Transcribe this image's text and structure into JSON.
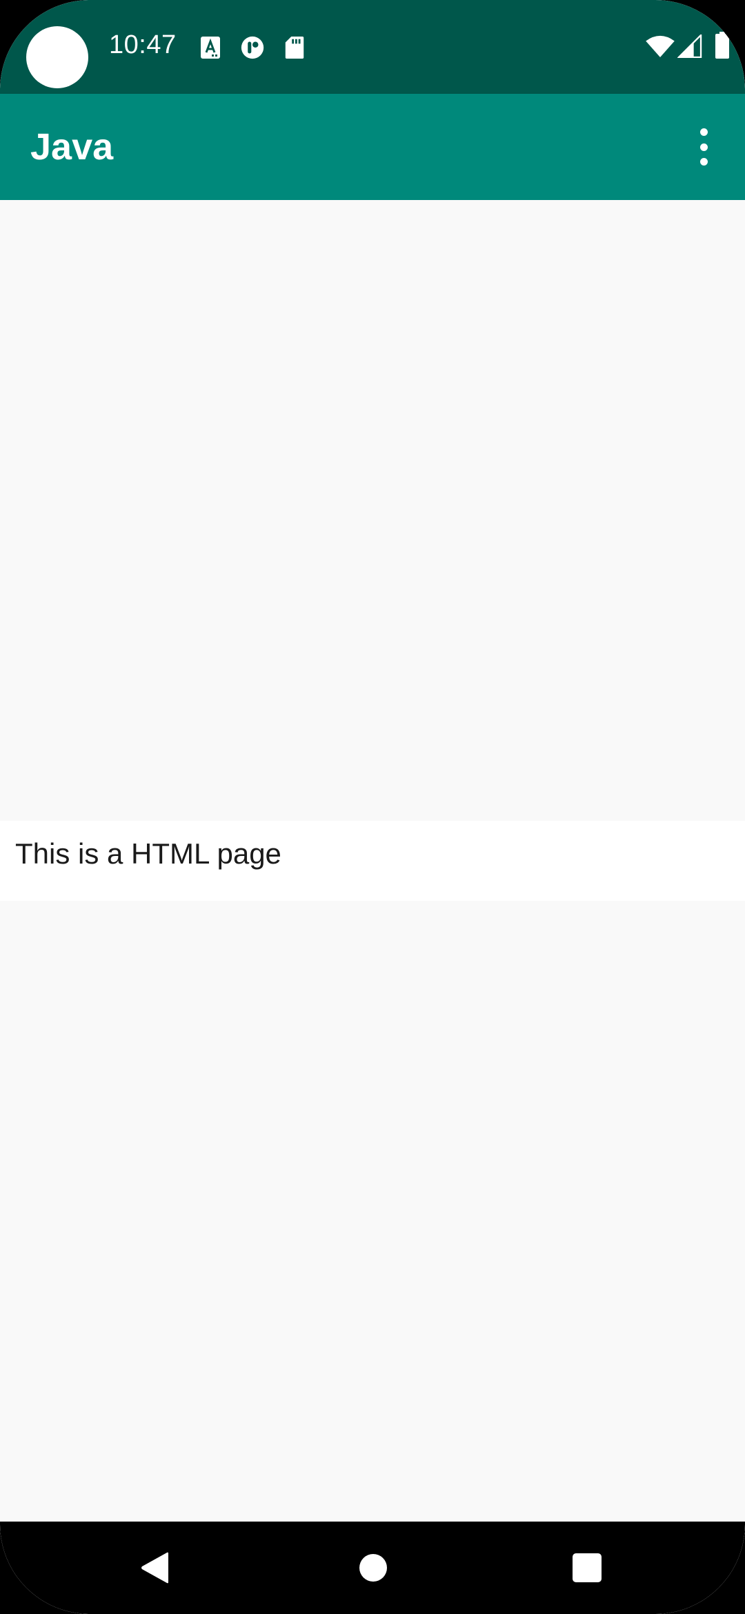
{
  "status_bar": {
    "time": "10:47",
    "icons": [
      "a-notification-icon",
      "p-notification-icon",
      "sd-card-icon",
      "wifi-icon",
      "cellular-signal-icon",
      "battery-icon"
    ]
  },
  "app_bar": {
    "title": "Java",
    "menu_icon": "more-vert-icon"
  },
  "content": {
    "html_text": "This is a HTML page"
  },
  "nav_bar": {
    "icons": [
      "back-icon",
      "home-icon",
      "recents-icon"
    ]
  },
  "colors": {
    "status_bar": "#00574b",
    "app_bar": "#00897b",
    "background": "#f9f9f9",
    "text": "#1a1a1a"
  }
}
